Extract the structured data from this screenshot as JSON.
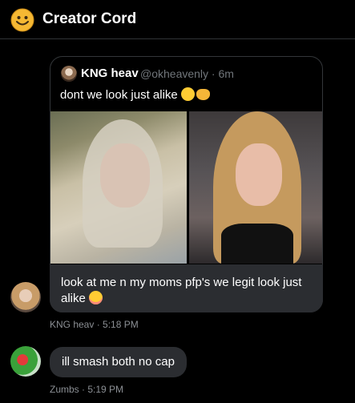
{
  "header": {
    "title": "Creator Cord",
    "logo_icon": "smiley-face-icon"
  },
  "quoted_tweet": {
    "name": "KNG heav",
    "handle_time": "@okheavenly · 6m",
    "text": "dont we look just alike",
    "emojis": [
      "relieved-face",
      "handshake"
    ]
  },
  "messages": [
    {
      "text": "look at me n my moms pfp's we legit look just alike",
      "emoji": "flushed-face",
      "meta": "KNG heav · 5:18 PM"
    },
    {
      "text": "ill smash both no cap",
      "meta": "Zumbs · 5:19 PM"
    }
  ],
  "colors": {
    "background": "#000000",
    "bubble": "#2b2d31",
    "muted_text": "#8b8f94",
    "accent_yellow": "#ffcc33"
  }
}
